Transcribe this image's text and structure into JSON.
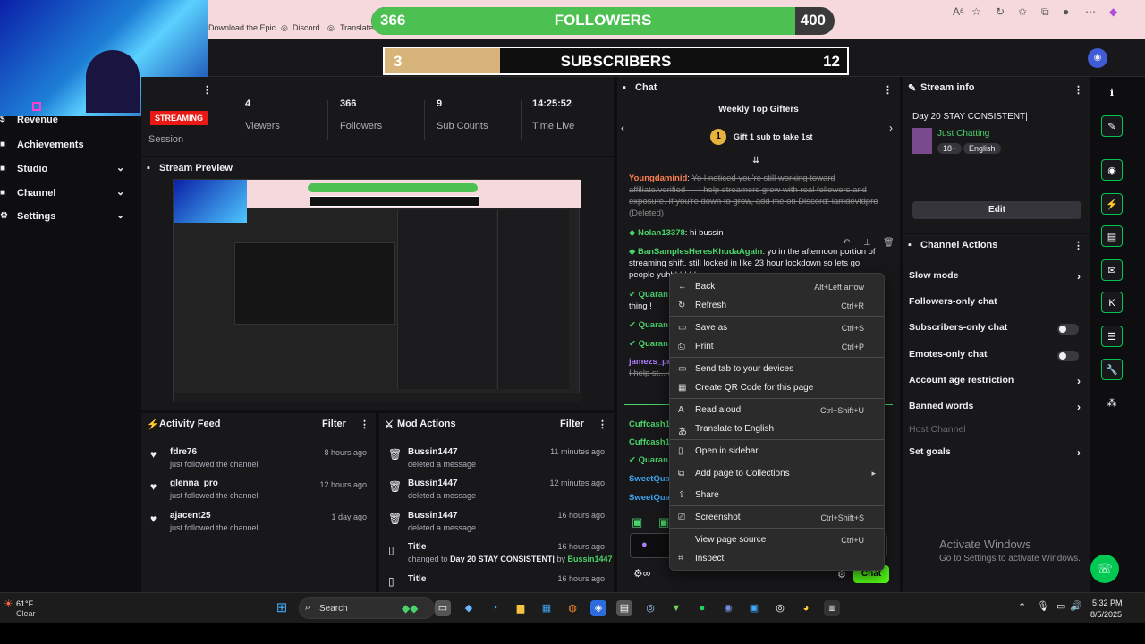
{
  "browser": {
    "bookmarks": [
      "Download the Epic...",
      "Discord",
      "Translate"
    ],
    "toolbar_icons": [
      "read-aloud-icon",
      "favorite-star-icon",
      "refresh-icon",
      "favorites-icon",
      "profile-icon",
      "menu-icon",
      "copilot-icon"
    ]
  },
  "overlay": {
    "followers": {
      "current": "366",
      "label": "FOLLOWERS",
      "goal": "400",
      "progress": 0.915,
      "color": "#4cc152"
    },
    "subscribers": {
      "current": "3",
      "label": "SUBSCRIBERS",
      "goal": "12",
      "progress": 0.25,
      "color": "#d7b57a"
    }
  },
  "sidebar": {
    "items": [
      {
        "label": "Revenue",
        "icon": "dollar-icon",
        "chevron": false
      },
      {
        "label": "Achievements",
        "icon": "trophy-icon",
        "chevron": false
      },
      {
        "label": "Studio",
        "icon": "studio-icon",
        "chevron": true
      },
      {
        "label": "Channel",
        "icon": "channel-icon",
        "chevron": true
      },
      {
        "label": "Settings",
        "icon": "gear-icon",
        "chevron": true
      }
    ]
  },
  "stats": {
    "badge": "STREAMING",
    "session_label": "Session",
    "items": [
      {
        "value": "4",
        "label": "Viewers"
      },
      {
        "value": "366",
        "label": "Followers"
      },
      {
        "value": "9",
        "label": "Sub Counts"
      },
      {
        "value": "14:25:52",
        "label": "Time Live"
      }
    ]
  },
  "preview": {
    "title": "Stream Preview"
  },
  "activity": {
    "title": "Activity Feed",
    "filter": "Filter",
    "rows": [
      {
        "name": "fdre76",
        "sub": "just followed the channel",
        "time": "8 hours ago"
      },
      {
        "name": "glenna_pro",
        "sub": "just followed the channel",
        "time": "12 hours ago"
      },
      {
        "name": "ajacent25",
        "sub": "just followed the channel",
        "time": "1 day ago"
      }
    ]
  },
  "mod": {
    "title": "Mod Actions",
    "filter": "Filter",
    "rows": [
      {
        "name": "Bussin1447",
        "sub": "deleted a message",
        "time": "11 minutes ago"
      },
      {
        "name": "Bussin1447",
        "sub": "deleted a message",
        "time": "12 minutes ago"
      },
      {
        "name": "Bussin1447",
        "sub": "deleted a message",
        "time": "16 hours ago"
      },
      {
        "name": "Title",
        "sub_prefix": "changed to",
        "sub_bold": "Day 20 STAY CONSISTENT|",
        "sub_by": "by",
        "sub_user": "Bussin1447",
        "time": "16 hours ago"
      },
      {
        "name": "Title",
        "sub": "",
        "time": "16 hours ago"
      }
    ]
  },
  "chat": {
    "title": "Chat",
    "gifters_title": "Weekly Top Gifters",
    "gift_rank": "1",
    "gift_text": "Gift 1 sub to take 1st",
    "messages": [
      {
        "user": "Youngdaminid",
        "text": "Yo I noticed you're still working toward affiliate/verified — I help streamers grow with real followers and exposure. If you're down to grow, add me on Discord: iamdevidpro",
        "deleted": "(Deleted)"
      },
      {
        "user": "Nolan13378",
        "text": "hi bussin"
      },
      {
        "user": "BanSamplesHeresKhudaAgain",
        "text": "yo in the afternoon portion of streaming shift. still locked in like 23 hour lockdown so lets go people yuhhhhhhh"
      },
      {
        "user": "Quaran",
        "text": "thing !"
      },
      {
        "user": "Quaran",
        "text": ""
      },
      {
        "user": "Quaran",
        "text": ""
      },
      {
        "user": "jamezs_pro",
        "text": "I help st... down to gr..."
      },
      {
        "user": "Cuffcash10",
        "text": ""
      },
      {
        "user": "Cuffcash10",
        "text": ""
      },
      {
        "user": "Quaran",
        "text": ""
      },
      {
        "user": "SweetQuat",
        "text": ""
      },
      {
        "user": "SweetQuat",
        "text": ""
      }
    ],
    "send_label": "Chat"
  },
  "context_menu": {
    "items": [
      {
        "label": "Back",
        "shortcut": "Alt+Left arrow",
        "icon": "back-arrow-icon"
      },
      {
        "label": "Refresh",
        "shortcut": "Ctrl+R",
        "icon": "refresh-icon"
      },
      {
        "label": "Save as",
        "shortcut": "Ctrl+S",
        "icon": "save-icon"
      },
      {
        "label": "Print",
        "shortcut": "Ctrl+P",
        "icon": "print-icon"
      },
      {
        "label": "Send tab to your devices",
        "shortcut": "",
        "icon": "send-tab-icon"
      },
      {
        "label": "Create QR Code for this page",
        "shortcut": "",
        "icon": "qr-code-icon"
      },
      {
        "label": "Read aloud",
        "shortcut": "Ctrl+Shift+U",
        "icon": "read-aloud-icon"
      },
      {
        "label": "Translate to English",
        "shortcut": "",
        "icon": "translate-icon"
      },
      {
        "label": "Open in sidebar",
        "shortcut": "",
        "icon": "sidebar-icon"
      },
      {
        "label": "Add page to Collections",
        "shortcut": "",
        "icon": "collections-icon"
      },
      {
        "label": "Share",
        "shortcut": "",
        "icon": "share-icon"
      },
      {
        "label": "Screenshot",
        "shortcut": "Ctrl+Shift+S",
        "icon": "screenshot-icon"
      },
      {
        "label": "View page source",
        "shortcut": "Ctrl+U",
        "icon": ""
      },
      {
        "label": "Inspect",
        "shortcut": "",
        "icon": "inspect-icon"
      }
    ]
  },
  "stream_info": {
    "title": "Stream info",
    "stream_title": "Day 20 STAY CONSISTENT|",
    "category": "Just Chatting",
    "tags": [
      "18+",
      "English"
    ],
    "edit_label": "Edit"
  },
  "channel_actions": {
    "title": "Channel Actions",
    "rows": [
      {
        "label": "Slow mode",
        "control": "chevron"
      },
      {
        "label": "Followers-only chat",
        "control": "toggle"
      },
      {
        "label": "Subscribers-only chat",
        "control": "toggle"
      },
      {
        "label": "Emotes-only chat",
        "control": "toggle"
      },
      {
        "label": "Account age restriction",
        "control": "chevron"
      },
      {
        "label": "Banned words",
        "control": "chevron"
      },
      {
        "label": "Host Channel",
        "control": "none"
      },
      {
        "label": "Set goals",
        "control": "chevron"
      }
    ]
  },
  "watermark": {
    "line1": "Activate Windows",
    "line2": "Go to Settings to activate Windows."
  },
  "taskbar": {
    "weather_temp": "61°F",
    "weather_text": "Clear",
    "search_placeholder": "Search",
    "time": "5:32 PM",
    "date": "8/5/2025"
  }
}
